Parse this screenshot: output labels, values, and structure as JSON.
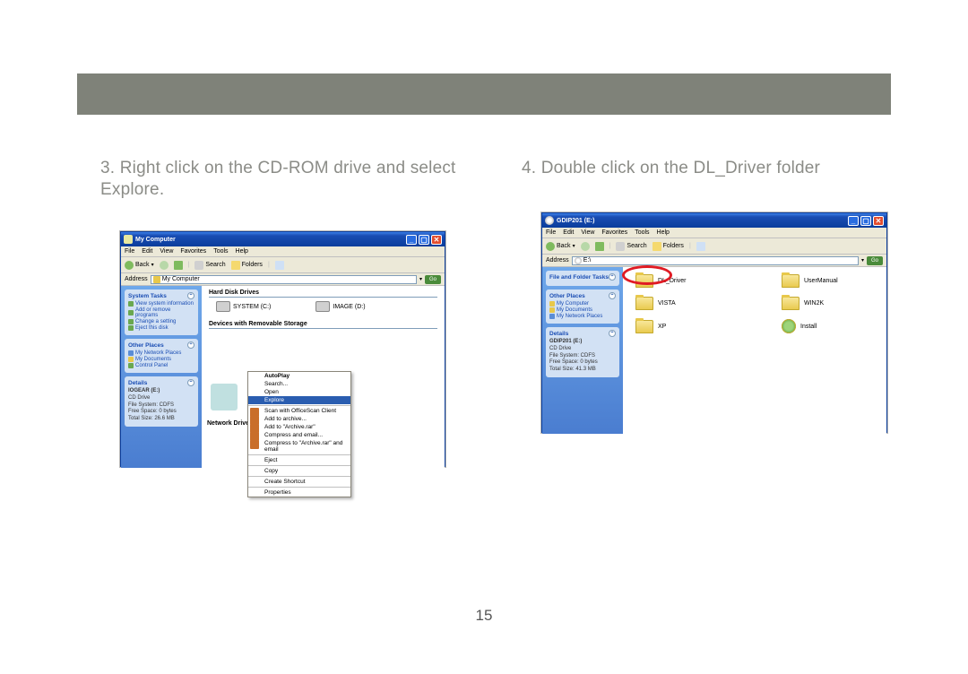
{
  "topbar_color": "#7f8279",
  "instructions": {
    "left": "3. Right click on the CD-ROM drive and select Explore.",
    "right": "4. Double click on the DL_Driver folder"
  },
  "page_number": "15",
  "win1": {
    "title": "My Computer",
    "menu": [
      "File",
      "Edit",
      "View",
      "Favorites",
      "Tools",
      "Help"
    ],
    "toolbar": {
      "back": "Back",
      "search": "Search",
      "folders": "Folders"
    },
    "address_label": "Address",
    "address_value": "My Computer",
    "go": "Go",
    "side": {
      "system_tasks": {
        "head": "System Tasks",
        "items": [
          "View system information",
          "Add or remove programs",
          "Change a setting",
          "Eject this disk"
        ]
      },
      "other_places": {
        "head": "Other Places",
        "items": [
          "My Network Places",
          "My Documents",
          "Control Panel"
        ]
      },
      "details": {
        "head": "Details",
        "name": "IOGEAR (E:)",
        "type": "CD Drive",
        "fs": "File System: CDFS",
        "free": "Free Space: 0 bytes",
        "total": "Total Size: 26.6 MB"
      }
    },
    "content": {
      "hard_disk": "Hard Disk Drives",
      "drives": [
        {
          "label": "SYSTEM (C:)"
        },
        {
          "label": "IMAGE (D:)"
        }
      ],
      "removable": "Devices with Removable Storage",
      "net_label": "Network Drives"
    },
    "context_menu": [
      {
        "label": "AutoPlay",
        "bold": true
      },
      {
        "label": "Search..."
      },
      {
        "label": "Open"
      },
      {
        "label": "Explore",
        "highlight": true
      },
      {
        "sep": true
      },
      {
        "label": "Scan with OfficeScan Client",
        "icon": true
      },
      {
        "label": "Add to archive...",
        "icon": true
      },
      {
        "label": "Add to \"Archive.rar\"",
        "icon": true
      },
      {
        "label": "Compress and email...",
        "icon": true
      },
      {
        "label": "Compress to \"Archive.rar\" and email",
        "icon": true
      },
      {
        "sep": true
      },
      {
        "label": "Eject"
      },
      {
        "sep": true
      },
      {
        "label": "Copy"
      },
      {
        "sep": true
      },
      {
        "label": "Create Shortcut"
      },
      {
        "sep": true
      },
      {
        "label": "Properties"
      }
    ]
  },
  "win2": {
    "title": "GDIP201 (E:)",
    "menu": [
      "File",
      "Edit",
      "View",
      "Favorites",
      "Tools",
      "Help"
    ],
    "toolbar": {
      "back": "Back",
      "search": "Search",
      "folders": "Folders"
    },
    "address_label": "Address",
    "address_value": "E:\\",
    "go": "Go",
    "side": {
      "file_tasks": {
        "head": "File and Folder Tasks"
      },
      "other_places": {
        "head": "Other Places",
        "items": [
          "My Computer",
          "My Documents",
          "My Network Places"
        ]
      },
      "details": {
        "head": "Details",
        "name": "GDIP201 (E:)",
        "type": "CD Drive",
        "fs": "File System: CDFS",
        "free": "Free Space: 0 bytes",
        "total": "Total Size: 41.3 MB"
      }
    },
    "folders": [
      {
        "label": "DL_Driver",
        "circled": true
      },
      {
        "label": "UserManual"
      },
      {
        "label": "VISTA"
      },
      {
        "label": "WIN2K"
      },
      {
        "label": "XP"
      },
      {
        "label": "Install",
        "install": true
      }
    ]
  }
}
